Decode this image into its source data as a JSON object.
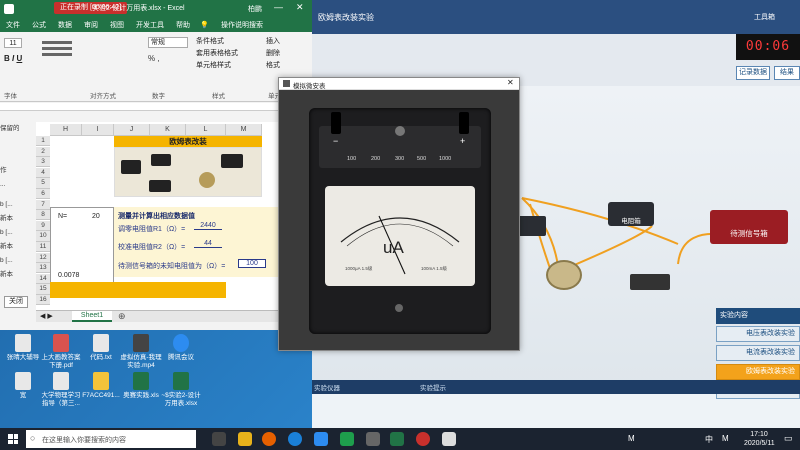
{
  "recording_badge": "正在录制 [00:06:42]",
  "excel": {
    "title": "实验2-设计万用表.xlsx - Excel",
    "user": "柏鹏",
    "tell_me": "操作说明搜索",
    "tabs": [
      "文件",
      "公式",
      "数据",
      "审阅",
      "视图",
      "开发工具",
      "帮助"
    ],
    "font_size": "11",
    "number_format": "常规",
    "ribbon_items": [
      "条件格式",
      "套用表格格式",
      "单元格样式",
      "插入",
      "删除",
      "格式"
    ],
    "ribbon_groups": [
      "字体",
      "对齐方式",
      "数字",
      "样式",
      "单元格"
    ],
    "col_headers": [
      "H",
      "I",
      "J",
      "K",
      "L",
      "M"
    ],
    "row_numbers": [
      "1",
      "2",
      "3",
      "4",
      "5",
      "6",
      "7",
      "8",
      "9",
      "10",
      "11",
      "12",
      "13",
      "14",
      "15",
      "16"
    ],
    "sheet_tab": "Sheet1",
    "left_labels": [
      "保留的",
      "作",
      "...",
      "b [...",
      "新本",
      "b [...",
      "新本",
      "b [...",
      "新本"
    ],
    "table_title": "欧姆表改装",
    "n_label": "N=",
    "n_value": "20",
    "h15_value": "0.0078",
    "section_title": "测量并计算出相应数据值",
    "r1_label": "调零电阻值R1（Ω）=",
    "r1_value": "2440",
    "r2_label": "校准电阻值R2（Ω）=",
    "r2_value": "44",
    "rx_label": "待测信号箱的未知电阻值为（Ω）=",
    "rx_value": "100",
    "close_label": "关闭"
  },
  "meter_dialog": {
    "title": "模拟微安表",
    "unit": "uA",
    "terminals": [
      "100",
      "200",
      "300",
      "500",
      "1000"
    ],
    "polarity_minus": "−",
    "polarity_plus": "+",
    "scale_left": "1000μA 1.5级",
    "scale_right": "100mA 1.5级"
  },
  "sim": {
    "title": "欧姆表改装实验",
    "tool_label": "工具箱",
    "timer": "00:06",
    "buttons": [
      "记录数据",
      "结果"
    ],
    "device_labels": [
      "电阻箱",
      "待测信号箱"
    ],
    "experiment_panel_title": "实验内容",
    "experiments": [
      "电压表改装实验",
      "电流表改装实验",
      "欧姆表改装实验",
      "万用表设计实验"
    ],
    "active_experiment": 2,
    "bottom_tabs": [
      "实验仪器",
      "实验提示"
    ]
  },
  "desktop_icons": [
    "张晴大辅导",
    "上大画教答案下册.pdf",
    "代码.txt",
    "虚拟仿真-我理实验.mp4",
    "腾讯会议",
    "宽",
    "大学物理学习指导（第三...",
    "F7ACC491...",
    "奥赛实践.xls",
    "~$实验2-设计万用表.xlsx"
  ],
  "taskbar": {
    "search_placeholder": "在这里输入你要搜索的内容",
    "time": "17:10",
    "date": "2020/5/11",
    "ime": "中",
    "ime_mode": "M"
  },
  "colors": {
    "excel_green": "#217346",
    "accent_yellow": "#f5b400",
    "active_experiment": "#f3a21b",
    "wire_orange": "#f0a020"
  }
}
